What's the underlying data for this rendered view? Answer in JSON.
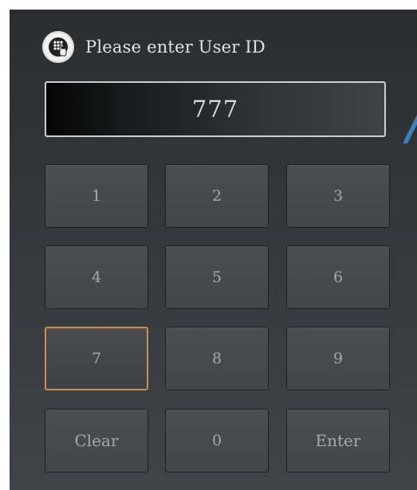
{
  "header": {
    "icon": "keypad-touch-icon",
    "label": "Please enter User ID"
  },
  "display": {
    "value": "777"
  },
  "keypad": {
    "keys": [
      "1",
      "2",
      "3",
      "4",
      "5",
      "6",
      "7",
      "8",
      "9",
      "Clear",
      "0",
      "Enter"
    ],
    "active_key": "7"
  },
  "colors": {
    "active_border": "#d4902c",
    "pointer": "#3d7fbf"
  }
}
